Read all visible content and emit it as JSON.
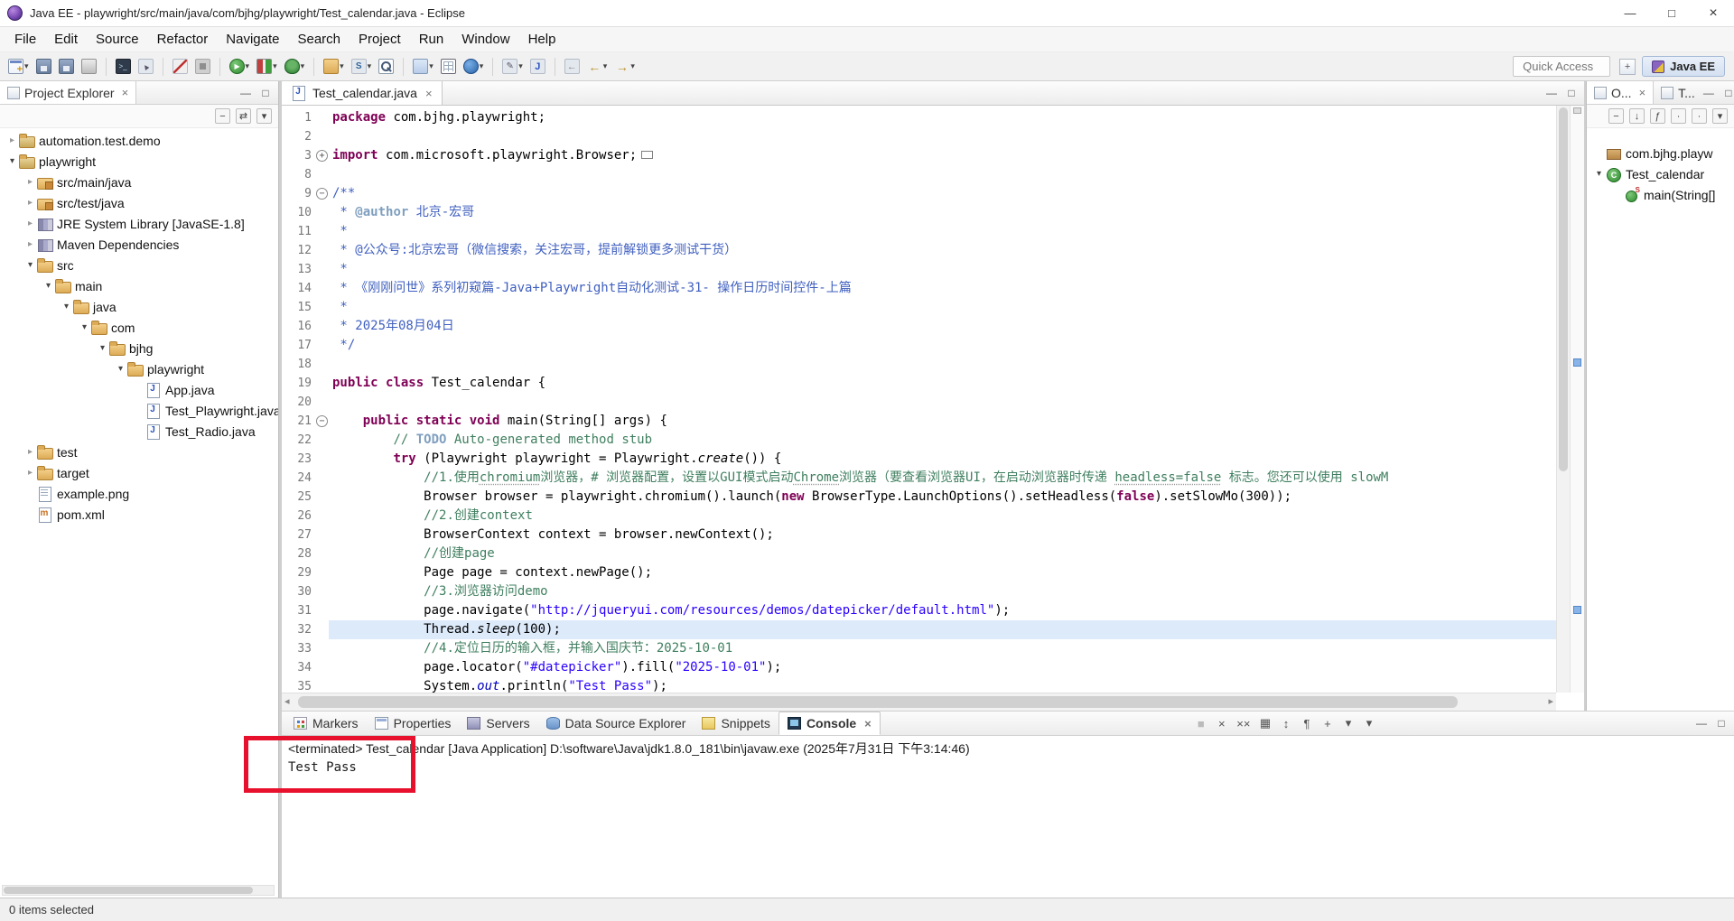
{
  "window": {
    "title": "Java EE - playwright/src/main/java/com/bjhg/playwright/Test_calendar.java - Eclipse"
  },
  "ui": {
    "min": "—",
    "max": "□",
    "close": "×",
    "dd": "▾",
    "collapsed": "▸",
    "expanded": "▾",
    "fold_plus": "+",
    "fold_minus": "−"
  },
  "menubar": [
    "File",
    "Edit",
    "Source",
    "Refactor",
    "Navigate",
    "Search",
    "Project",
    "Run",
    "Window",
    "Help"
  ],
  "toolbar": {
    "quick_access_label": "Quick Access",
    "perspective_label": "Java EE",
    "buttons": [
      {
        "icon": "new-wizard",
        "dd": true
      },
      {
        "icon": "save"
      },
      {
        "icon": "save-all"
      },
      {
        "icon": "print"
      },
      {
        "sep": true
      },
      {
        "icon": "open-terminal"
      },
      {
        "icon": "select"
      },
      {
        "sep": true
      },
      {
        "icon": "skip-breakpoints"
      },
      {
        "icon": "stop"
      },
      {
        "sep": true
      },
      {
        "icon": "run",
        "dd": true
      },
      {
        "icon": "coverage",
        "dd": true
      },
      {
        "icon": "debug",
        "dd": true
      },
      {
        "sep": true
      },
      {
        "icon": "new-java-project",
        "dd": true
      },
      {
        "icon": "new-servlet",
        "dd": true
      },
      {
        "icon": "search"
      },
      {
        "sep": true
      },
      {
        "icon": "open-task",
        "dd": true
      },
      {
        "icon": "data-grid"
      },
      {
        "icon": "web-browser",
        "dd": true
      },
      {
        "sep": true
      },
      {
        "icon": "annotations",
        "dd": true
      },
      {
        "icon": "java-element"
      },
      {
        "sep": true
      },
      {
        "icon": "last-edit"
      },
      {
        "icon": "back",
        "dd": true
      },
      {
        "icon": "forward",
        "dd": true
      }
    ]
  },
  "explorer": {
    "tab_label": "Project Explorer",
    "toolbar": [
      {
        "n": "collapse-all",
        "g": "−"
      },
      {
        "n": "link-with-editor",
        "g": "⇄"
      },
      {
        "n": "view-menu",
        "g": "▾"
      }
    ],
    "items": [
      {
        "d": 0,
        "a": "c",
        "i": "project",
        "t": "automation.test.demo"
      },
      {
        "d": 0,
        "a": "e",
        "i": "project",
        "t": "playwright"
      },
      {
        "d": 1,
        "a": "c",
        "i": "srcpkg",
        "t": "src/main/java"
      },
      {
        "d": 1,
        "a": "c",
        "i": "srcpkg",
        "t": "src/test/java"
      },
      {
        "d": 1,
        "a": "c",
        "i": "library",
        "t": "JRE System Library [JavaSE-1.8]"
      },
      {
        "d": 1,
        "a": "c",
        "i": "library",
        "t": "Maven Dependencies"
      },
      {
        "d": 1,
        "a": "e",
        "i": "folder",
        "t": "src"
      },
      {
        "d": 2,
        "a": "e",
        "i": "folder",
        "t": "main"
      },
      {
        "d": 3,
        "a": "e",
        "i": "folder",
        "t": "java"
      },
      {
        "d": 4,
        "a": "e",
        "i": "folder",
        "t": "com"
      },
      {
        "d": 5,
        "a": "e",
        "i": "folder",
        "t": "bjhg"
      },
      {
        "d": 6,
        "a": "e",
        "i": "folder",
        "t": "playwright"
      },
      {
        "d": 7,
        "a": "",
        "i": "jfile",
        "t": "App.java"
      },
      {
        "d": 7,
        "a": "",
        "i": "jfile",
        "t": "Test_Playwright.java"
      },
      {
        "d": 7,
        "a": "",
        "i": "jfile",
        "t": "Test_Radio.java"
      },
      {
        "d": 1,
        "a": "c",
        "i": "folder",
        "t": "test"
      },
      {
        "d": 1,
        "a": "c",
        "i": "folder",
        "t": "target"
      },
      {
        "d": 1,
        "a": "",
        "i": "file",
        "t": "example.png"
      },
      {
        "d": 1,
        "a": "",
        "i": "mfile",
        "t": "pom.xml"
      }
    ]
  },
  "editor": {
    "tab_label": "Test_calendar.java",
    "lines": [
      {
        "n": 1,
        "s": [
          [
            "kw",
            "package"
          ],
          [
            "pl",
            " com.bjhg.playwright;"
          ]
        ]
      },
      {
        "n": 2,
        "s": []
      },
      {
        "n": 3,
        "f": "+",
        "s": [
          [
            "kw",
            "import"
          ],
          [
            "pl",
            " com.microsoft.playwright.Browser;"
          ],
          [
            "fb",
            ""
          ]
        ]
      },
      {
        "n": 8,
        "s": []
      },
      {
        "n": 9,
        "f": "-",
        "s": [
          [
            "dc",
            "/**"
          ]
        ]
      },
      {
        "n": 10,
        "s": [
          [
            "dc",
            " * "
          ],
          [
            "tg",
            "@author"
          ],
          [
            "dc",
            " 北京-宏哥"
          ]
        ]
      },
      {
        "n": 11,
        "s": [
          [
            "dc",
            " *"
          ]
        ]
      },
      {
        "n": 12,
        "s": [
          [
            "dc",
            " * @公众号:北京宏哥（微信搜索，关注宏哥，提前解锁更多测试干货）"
          ]
        ]
      },
      {
        "n": 13,
        "s": [
          [
            "dc",
            " *"
          ]
        ]
      },
      {
        "n": 14,
        "s": [
          [
            "dc",
            " * 《刚刚问世》系列初窥篇-Java+Playwright自动化测试-31- 操作日历时间控件-上篇"
          ]
        ]
      },
      {
        "n": 15,
        "s": [
          [
            "dc",
            " *"
          ]
        ]
      },
      {
        "n": 16,
        "s": [
          [
            "dc",
            " * 2025年08月04日"
          ]
        ]
      },
      {
        "n": 17,
        "s": [
          [
            "dc",
            " */"
          ]
        ]
      },
      {
        "n": 18,
        "s": []
      },
      {
        "n": 19,
        "s": [
          [
            "kw",
            "public"
          ],
          [
            "pl",
            " "
          ],
          [
            "kw",
            "class"
          ],
          [
            "pl",
            " Test_calendar {"
          ]
        ]
      },
      {
        "n": 20,
        "s": []
      },
      {
        "n": 21,
        "f": "-",
        "s": [
          [
            "pl",
            "    "
          ],
          [
            "kw",
            "public"
          ],
          [
            "pl",
            " "
          ],
          [
            "kw",
            "static"
          ],
          [
            "pl",
            " "
          ],
          [
            "kw",
            "void"
          ],
          [
            "pl",
            " main(String[] args) {"
          ]
        ]
      },
      {
        "n": 22,
        "s": [
          [
            "pl",
            "        "
          ],
          [
            "cm",
            "// "
          ],
          [
            "tg",
            "TODO"
          ],
          [
            "cm",
            " Auto-generated method stub"
          ]
        ]
      },
      {
        "n": 23,
        "s": [
          [
            "pl",
            "        "
          ],
          [
            "kw",
            "try"
          ],
          [
            "pl",
            " (Playwright playwright = Playwright."
          ],
          [
            "it",
            "create"
          ],
          [
            "pl",
            "()) {"
          ]
        ]
      },
      {
        "n": 24,
        "s": [
          [
            "pl",
            "            "
          ],
          [
            "cm",
            "//1.使用"
          ],
          [
            "cu",
            "chromium"
          ],
          [
            "cm",
            "浏览器，# 浏览器配置，设置以GUI模式启动"
          ],
          [
            "cu",
            "Chrome"
          ],
          [
            "cm",
            "浏览器（要查看浏览器UI，在启动浏览器时传递 "
          ],
          [
            "cu",
            "headless=false"
          ],
          [
            "cm",
            " 标志。您还可以使用 slowM"
          ]
        ]
      },
      {
        "n": 25,
        "s": [
          [
            "pl",
            "            Browser browser = playwright.chromium().launch("
          ],
          [
            "kw",
            "new"
          ],
          [
            "pl",
            " BrowserType.LaunchOptions().setHeadless("
          ],
          [
            "kw",
            "false"
          ],
          [
            "pl",
            ").setSlowMo(300));"
          ]
        ]
      },
      {
        "n": 26,
        "s": [
          [
            "pl",
            "            "
          ],
          [
            "cm",
            "//2.创建context"
          ]
        ]
      },
      {
        "n": 27,
        "s": [
          [
            "pl",
            "            BrowserContext context = browser.newContext();"
          ]
        ]
      },
      {
        "n": 28,
        "s": [
          [
            "pl",
            "            "
          ],
          [
            "cm",
            "//创建page"
          ]
        ]
      },
      {
        "n": 29,
        "s": [
          [
            "pl",
            "            Page page = context.newPage();"
          ]
        ]
      },
      {
        "n": 30,
        "s": [
          [
            "pl",
            "            "
          ],
          [
            "cm",
            "//3.浏览器访问demo"
          ]
        ]
      },
      {
        "n": 31,
        "s": [
          [
            "pl",
            "            page.navigate("
          ],
          [
            "st",
            "\"http://jqueryui.com/resources/demos/datepicker/default.html\""
          ],
          [
            "pl",
            ");"
          ]
        ]
      },
      {
        "n": 32,
        "h": true,
        "s": [
          [
            "pl",
            "            Thread."
          ],
          [
            "it",
            "sleep"
          ],
          [
            "pl",
            "(100);"
          ]
        ]
      },
      {
        "n": 33,
        "s": [
          [
            "pl",
            "            "
          ],
          [
            "cm",
            "//4.定位日历的输入框，并输入国庆节：2025-10-01"
          ]
        ]
      },
      {
        "n": 34,
        "s": [
          [
            "pl",
            "            page.locator("
          ],
          [
            "st",
            "\"#datepicker\""
          ],
          [
            "pl",
            ").fill("
          ],
          [
            "st",
            "\"2025-10-01\""
          ],
          [
            "pl",
            ");"
          ]
        ]
      },
      {
        "n": 35,
        "s": [
          [
            "pl",
            "            System."
          ],
          [
            "fd",
            "out"
          ],
          [
            "pl",
            ".println("
          ],
          [
            "st",
            "\"Test Pass\""
          ],
          [
            "pl",
            ");"
          ]
        ]
      }
    ]
  },
  "outline": {
    "tabs": [
      {
        "label": "O...",
        "active": true
      },
      {
        "label": "T..."
      }
    ],
    "toolbar": [
      {
        "n": "collapse-all",
        "g": "−"
      },
      {
        "n": "sort",
        "g": "↓"
      },
      {
        "n": "hide-fields",
        "g": "ƒ"
      },
      {
        "n": "hide-static-members",
        "g": "∙"
      },
      {
        "n": "hide-non-public",
        "g": "·"
      },
      {
        "n": "view-menu",
        "g": "▾"
      }
    ],
    "items": [
      {
        "d": 0,
        "a": "",
        "i": "package",
        "t": "com.bjhg.playw"
      },
      {
        "d": 0,
        "a": "e",
        "i": "class",
        "t": "Test_calendar"
      },
      {
        "d": 1,
        "a": "",
        "i": "method-s",
        "t": "main(String[]"
      }
    ]
  },
  "bottom": {
    "tabs": [
      {
        "i": "markers",
        "t": "Markers"
      },
      {
        "i": "properties",
        "t": "Properties"
      },
      {
        "i": "servers",
        "t": "Servers"
      },
      {
        "i": "datasource",
        "t": "Data Source Explorer"
      },
      {
        "i": "snippets",
        "t": "Snippets"
      },
      {
        "i": "console",
        "t": "Console",
        "active": true
      }
    ],
    "console_toolbar": [
      {
        "n": "terminate",
        "g": "■"
      },
      {
        "n": "remove-launch",
        "g": "×"
      },
      {
        "n": "remove-all-terminated",
        "g": "××"
      },
      {
        "n": "clear-console",
        "g": "▦"
      },
      {
        "n": "scroll-lock",
        "g": "↕"
      },
      {
        "n": "word-wrap",
        "g": "¶"
      },
      {
        "n": "pin-console",
        "g": "+"
      },
      {
        "n": "display-selected-console",
        "g": "▾"
      },
      {
        "n": "open-console",
        "g": "▾"
      }
    ],
    "console": {
      "header": "<terminated> Test_calendar [Java Application] D:\\software\\Java\\jdk1.8.0_181\\bin\\javaw.exe (2025年7月31日 下午3:14:46)",
      "output": "Test Pass"
    }
  },
  "statusbar": {
    "text": "0 items selected"
  },
  "annotation": {
    "color": "#e8112d"
  }
}
